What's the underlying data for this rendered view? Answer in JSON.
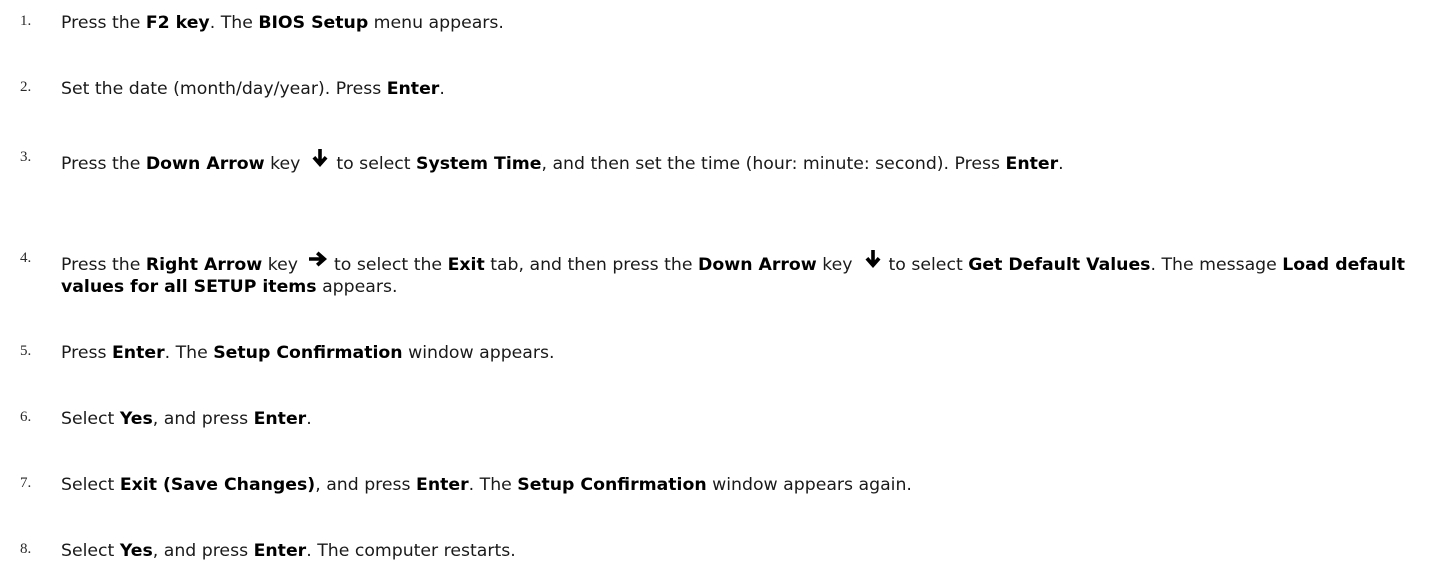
{
  "steps": [
    {
      "number": "1.",
      "parts": [
        "Press the ",
        "F2 key",
        ". The ",
        "BIOS Setup",
        " menu appears."
      ]
    },
    {
      "number": "2.",
      "parts": [
        "Set the date (month/day/year). Press ",
        "Enter",
        "."
      ]
    },
    {
      "number": "3.",
      "parts": [
        "Press the ",
        "Down Arrow",
        " key",
        "to select ",
        "System Time",
        ", and then set the time (hour: minute: second). Press ",
        "Enter",
        "."
      ],
      "icons": [
        "down-arrow-icon"
      ]
    },
    {
      "number": "4.",
      "parts": [
        "Press the ",
        "Right Arrow",
        " key",
        "to select the ",
        "Exit",
        " tab, and then press the ",
        "Down Arrow",
        " key",
        "to select ",
        "Get Default Values",
        ". The message ",
        "Load default values for all SETUP items",
        " appears."
      ],
      "icons": [
        "right-arrow-icon",
        "down-arrow-icon"
      ]
    },
    {
      "number": "5.",
      "parts": [
        "Press ",
        "Enter",
        ". The ",
        "Setup Confirmation",
        " window appears."
      ]
    },
    {
      "number": "6.",
      "parts": [
        "Select ",
        "Yes",
        ", and press ",
        "Enter",
        "."
      ]
    },
    {
      "number": "7.",
      "parts": [
        "Select ",
        "Exit (Save Changes)",
        ", and press ",
        "Enter",
        ". The ",
        "Setup Confirmation",
        " window appears again."
      ]
    },
    {
      "number": "8.",
      "parts": [
        "Select ",
        "Yes",
        ", and press ",
        "Enter",
        ". The computer restarts."
      ]
    }
  ],
  "colors": {
    "text": "#1a1a1a",
    "number": "#2a2a2a",
    "background": "#ffffff"
  }
}
